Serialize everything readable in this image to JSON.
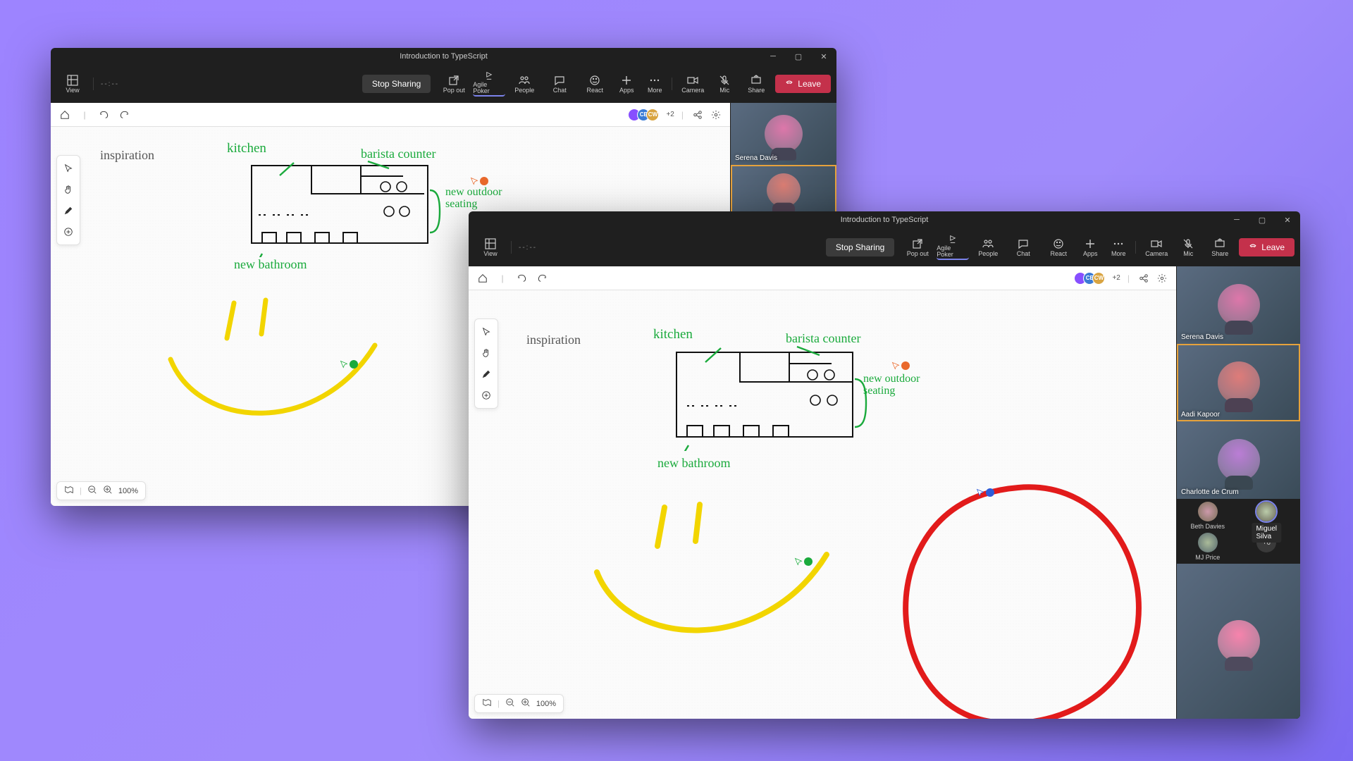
{
  "title": "Introduction to TypeScript",
  "timer": "--:--",
  "stop_sharing": "Stop Sharing",
  "leave": "Leave",
  "toolbar": {
    "view": "View",
    "popout": "Pop out",
    "agile": "Agile Poker",
    "people": "People",
    "chat": "Chat",
    "react": "React",
    "apps": "Apps",
    "more": "More",
    "camera": "Camera",
    "mic": "Mic",
    "share": "Share"
  },
  "zoom": "100%",
  "plus_count": "+2",
  "annotations": {
    "inspiration": "inspiration",
    "kitchen": "kitchen",
    "barista": "barista counter",
    "outdoor": "new outdoor seating",
    "bathroom": "new bathroom"
  },
  "participants_small": [
    {
      "name": "Serena Davis"
    }
  ],
  "participants_large": [
    {
      "name": "Serena Davis"
    },
    {
      "name": "Aadi Kapoor",
      "active": true
    },
    {
      "name": "Charlotte de Crum"
    }
  ],
  "thumbs": [
    {
      "name": "Beth Davies"
    },
    {
      "name": "Miguel Silva",
      "ring": true,
      "tooltip": "Miguel Silva"
    },
    {
      "name": "MJ Price"
    },
    {
      "name": "+6",
      "overflow": true
    }
  ],
  "colors": {
    "green": "#1aaa3c",
    "yellow": "#f2d500",
    "red": "#e21b1b",
    "leave": "#c4314b"
  },
  "avatar_bar": [
    {
      "initials": "",
      "color": "#874fff"
    },
    {
      "initials": "CB",
      "color": "#3a7bd5"
    },
    {
      "initials": "CW",
      "color": "#d9a441"
    }
  ]
}
